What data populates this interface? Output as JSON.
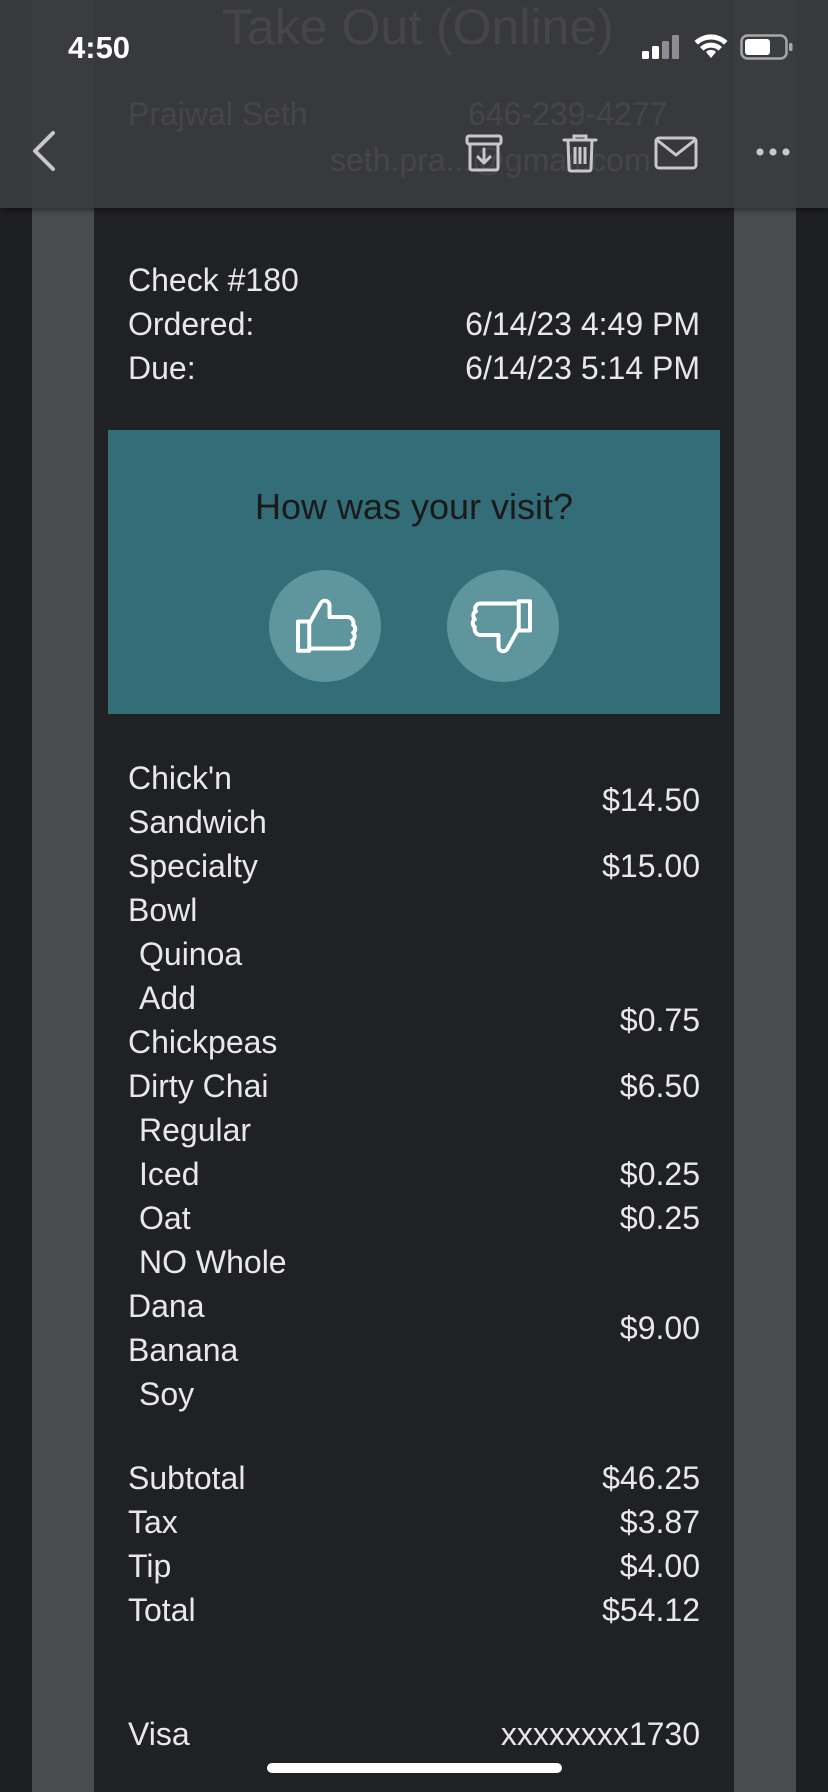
{
  "status_bar": {
    "time": "4:50"
  },
  "background_header": {
    "title": "Take Out (Online)",
    "customer_name": "Prajwal Seth",
    "customer_phone": "646-239-4277",
    "customer_email": "seth.pra...@gmail.com"
  },
  "toolbar": {
    "back_icon": "chevron-left-icon",
    "archive_icon": "archive-icon",
    "delete_icon": "trash-icon",
    "mail_icon": "mail-icon",
    "more_icon": "more-horizontal-icon"
  },
  "check": {
    "number": "Check #180",
    "ordered_label": "Ordered:",
    "ordered_value": "6/14/23 4:49 PM",
    "due_label": "Due:",
    "due_value": "6/14/23 5:14 PM"
  },
  "feedback": {
    "question": "How was your visit?",
    "thumbs_up_icon": "thumbs-up-icon",
    "thumbs_down_icon": "thumbs-down-icon"
  },
  "items": [
    {
      "lines": [
        "Chick'n",
        "Sandwich"
      ],
      "price": "$14.50",
      "modifier": false
    },
    {
      "lines": [
        "Specialty",
        "Bowl"
      ],
      "price": "$15.00",
      "modifier": false
    },
    {
      "lines": [
        "Quinoa"
      ],
      "price": "",
      "modifier": true
    },
    {
      "lines": [
        "Add",
        "Chickpeas"
      ],
      "price": "$0.75",
      "modifier": true
    },
    {
      "lines": [
        "Dirty Chai"
      ],
      "price": "$6.50",
      "modifier": false
    },
    {
      "lines": [
        "Regular"
      ],
      "price": "",
      "modifier": true
    },
    {
      "lines": [
        "Iced"
      ],
      "price": "$0.25",
      "modifier": true
    },
    {
      "lines": [
        "Oat"
      ],
      "price": "$0.25",
      "modifier": true
    },
    {
      "lines": [
        "NO Whole"
      ],
      "price": "",
      "modifier": true
    },
    {
      "lines": [
        "Dana",
        "Banana"
      ],
      "price": "$9.00",
      "modifier": false
    },
    {
      "lines": [
        "Soy"
      ],
      "price": "",
      "modifier": true
    }
  ],
  "totals": {
    "subtotal_label": "Subtotal",
    "subtotal": "$46.25",
    "tax_label": "Tax",
    "tax": "$3.87",
    "tip_label": "Tip",
    "tip": "$4.00",
    "total_label": "Total",
    "total": "$54.12"
  },
  "payment": {
    "method": "Visa",
    "card": "xxxxxxxx1730"
  },
  "colors": {
    "feedback_bg": "#326d78",
    "thumb_bg": "#5f959d",
    "page_bg": "#202124"
  }
}
